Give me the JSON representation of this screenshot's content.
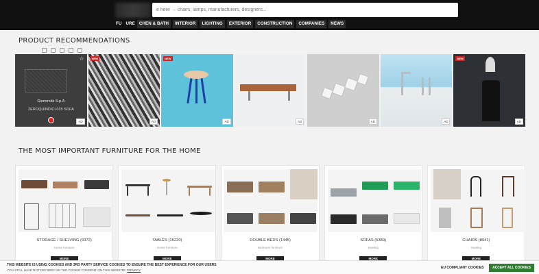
{
  "header": {
    "search_placeholder": "e here → chairs, lamps, manufacturers, designers...",
    "nav": [
      {
        "label": "FU"
      },
      {
        "label": "URE"
      },
      {
        "label": "CHEN & BATH"
      },
      {
        "label": "INTERIOR"
      },
      {
        "label": "LIGHTING"
      },
      {
        "label": "EXTERIOR"
      },
      {
        "label": "CONSTRUCTION"
      },
      {
        "label": "COMPANIES"
      },
      {
        "label": "NEWS"
      }
    ]
  },
  "recommendations": {
    "title": "PRODUCT RECOMMENDATIONS",
    "products": [
      {
        "brand": "Giommobi S.p.A",
        "name": "ZEROQUINDICI.015 SOFA",
        "ad": "AD"
      },
      {
        "badge": "NEW",
        "ad": "AD"
      },
      {
        "badge": "NEW",
        "ad": "AD"
      },
      {
        "ad": "AD"
      },
      {
        "ad": "AD"
      },
      {
        "ad": "AD"
      },
      {
        "badge": "NEW",
        "ad": "AD"
      }
    ]
  },
  "furniture": {
    "title": "THE MOST IMPORTANT FURNITURE FOR THE HOME",
    "more_label": "MORE",
    "categories": [
      {
        "title": "STORAGE / SHELVING (9372)",
        "sub": "Home furniture"
      },
      {
        "title": "TABLES (15220)",
        "sub": "Home furniture"
      },
      {
        "title": "DOUBLE BEDS (1445)",
        "sub": "Bedroom furniture"
      },
      {
        "title": "SOFAS (6389)",
        "sub": "Seating"
      },
      {
        "title": "CHAIRS (8941)",
        "sub": "Seating"
      }
    ]
  },
  "cookie": {
    "line1": "THIS WEBSITE IS USING COOKIES AND 3RD PARTY SERVICE COOKIES TO ENSURE THE BEST EXPERIENCE FOR OUR USERS",
    "line2": "YOU STILL HAVE NOT DECIDED ON THE COOKIE CONSENT ON THIS WEBSITE.",
    "link": "PRIVACY",
    "eu": "EU COMPLIANT COOKIES",
    "accept": "ACCEPT ALL COOKIES"
  },
  "colors": {
    "accept": "#2e7d32",
    "badge_new": "#c62828",
    "header": "#111111"
  }
}
